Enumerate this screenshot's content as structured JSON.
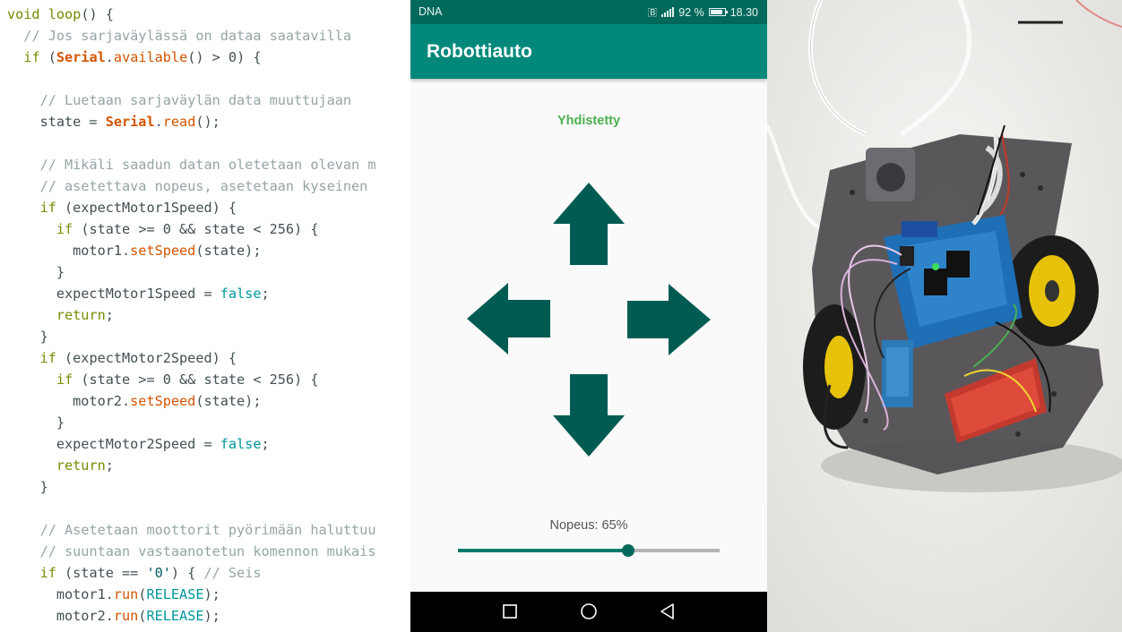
{
  "code": {
    "lines": [
      [
        [
          "kw",
          "void"
        ],
        [
          "pl",
          " "
        ],
        [
          "kw",
          "loop"
        ],
        [
          "pl",
          "() {"
        ]
      ],
      [
        [
          "pl",
          "  "
        ],
        [
          "cm",
          "// Jos sarjaväylässä on dataa saatavilla"
        ]
      ],
      [
        [
          "pl",
          "  "
        ],
        [
          "kw",
          "if"
        ],
        [
          "pl",
          " ("
        ],
        [
          "obj",
          "Serial"
        ],
        [
          "pl",
          "."
        ],
        [
          "fn",
          "available"
        ],
        [
          "pl",
          "() > 0) {"
        ]
      ],
      [],
      [
        [
          "pl",
          "    "
        ],
        [
          "cm",
          "// Luetaan sarjaväylän data muuttujaan"
        ]
      ],
      [
        [
          "pl",
          "    state = "
        ],
        [
          "obj",
          "Serial"
        ],
        [
          "pl",
          "."
        ],
        [
          "fn",
          "read"
        ],
        [
          "pl",
          "();"
        ]
      ],
      [],
      [
        [
          "pl",
          "    "
        ],
        [
          "cm",
          "// Mikäli saadun datan oletetaan olevan m"
        ]
      ],
      [
        [
          "pl",
          "    "
        ],
        [
          "cm",
          "// asetettava nopeus, asetetaan kyseinen"
        ]
      ],
      [
        [
          "pl",
          "    "
        ],
        [
          "kw",
          "if"
        ],
        [
          "pl",
          " (expectMotor1Speed) {"
        ]
      ],
      [
        [
          "pl",
          "      "
        ],
        [
          "kw",
          "if"
        ],
        [
          "pl",
          " (state >= 0 && state < 256) {"
        ]
      ],
      [
        [
          "pl",
          "        motor1."
        ],
        [
          "fn",
          "setSpeed"
        ],
        [
          "pl",
          "(state);"
        ]
      ],
      [
        [
          "pl",
          "      }"
        ]
      ],
      [
        [
          "pl",
          "      expectMotor1Speed = "
        ],
        [
          "lit",
          "false"
        ],
        [
          "pl",
          ";"
        ]
      ],
      [
        [
          "pl",
          "      "
        ],
        [
          "kw",
          "return"
        ],
        [
          "pl",
          ";"
        ]
      ],
      [
        [
          "pl",
          "    }"
        ]
      ],
      [
        [
          "pl",
          "    "
        ],
        [
          "kw",
          "if"
        ],
        [
          "pl",
          " (expectMotor2Speed) {"
        ]
      ],
      [
        [
          "pl",
          "      "
        ],
        [
          "kw",
          "if"
        ],
        [
          "pl",
          " (state >= 0 && state < 256) {"
        ]
      ],
      [
        [
          "pl",
          "        motor2."
        ],
        [
          "fn",
          "setSpeed"
        ],
        [
          "pl",
          "(state);"
        ]
      ],
      [
        [
          "pl",
          "      }"
        ]
      ],
      [
        [
          "pl",
          "      expectMotor2Speed = "
        ],
        [
          "lit",
          "false"
        ],
        [
          "pl",
          ";"
        ]
      ],
      [
        [
          "pl",
          "      "
        ],
        [
          "kw",
          "return"
        ],
        [
          "pl",
          ";"
        ]
      ],
      [
        [
          "pl",
          "    }"
        ]
      ],
      [],
      [
        [
          "pl",
          "    "
        ],
        [
          "cm",
          "// Asetetaan moottorit pyörimään haluttuu"
        ]
      ],
      [
        [
          "pl",
          "    "
        ],
        [
          "cm",
          "// suuntaan vastaanotetun komennon mukais"
        ]
      ],
      [
        [
          "pl",
          "    "
        ],
        [
          "kw",
          "if"
        ],
        [
          "pl",
          " (state == "
        ],
        [
          "str",
          "'0'"
        ],
        [
          "pl",
          ") { "
        ],
        [
          "cm",
          "// Seis"
        ]
      ],
      [
        [
          "pl",
          "      motor1."
        ],
        [
          "fn",
          "run"
        ],
        [
          "pl",
          "("
        ],
        [
          "lit",
          "RELEASE"
        ],
        [
          "pl",
          ");"
        ]
      ],
      [
        [
          "pl",
          "      motor2."
        ],
        [
          "fn",
          "run"
        ],
        [
          "pl",
          "("
        ],
        [
          "lit",
          "RELEASE"
        ],
        [
          "pl",
          ");"
        ]
      ]
    ]
  },
  "phone": {
    "status_bar": {
      "carrier": "DNA",
      "battery_text": "92 %",
      "battery_level": 0.92,
      "time": "18.30",
      "icons": [
        "bluetooth-icon",
        "signal-icon",
        "battery-icon"
      ]
    },
    "app_bar": {
      "title": "Robottiauto"
    },
    "connection_status": "Yhdistetty",
    "arrow_color": "#005c53",
    "controls": [
      "up-arrow-icon",
      "left-arrow-icon",
      "right-arrow-icon",
      "down-arrow-icon"
    ],
    "speed": {
      "label": "Nopeus: 65%",
      "value": 0.65
    },
    "nav_buttons": [
      "recents-icon",
      "home-icon",
      "back-icon"
    ]
  },
  "colors": {
    "accent": "#00897b",
    "status_bar": "#00695c",
    "connected": "#4caf50"
  }
}
